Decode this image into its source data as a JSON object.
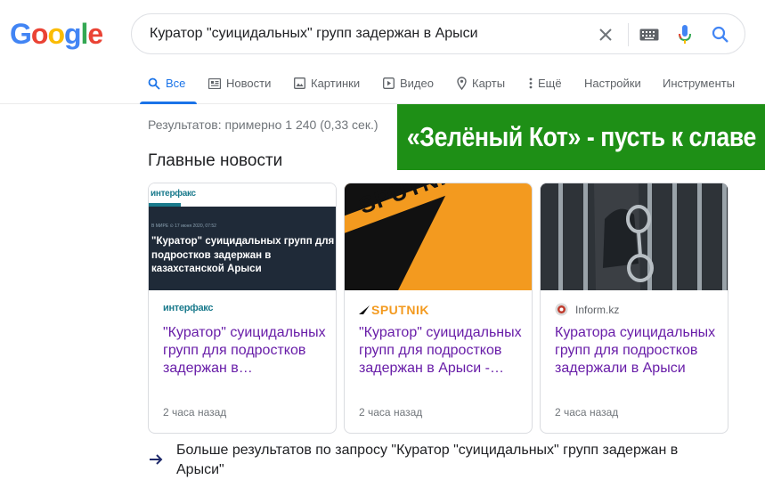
{
  "logo": {
    "letters": [
      "G",
      "o",
      "o",
      "g",
      "l",
      "e"
    ],
    "colors": [
      "#4285f4",
      "#ea4335",
      "#fbbc05",
      "#4285f4",
      "#34a853",
      "#ea4335"
    ]
  },
  "search": {
    "query": "Куратор \"суицидальных\" групп задержан в Арыси",
    "icons": [
      "clear-icon",
      "keyboard-icon",
      "mic-icon",
      "search-icon"
    ]
  },
  "tabs": [
    {
      "label": "Все",
      "icon": "search-icon"
    },
    {
      "label": "Новости",
      "icon": "news-icon"
    },
    {
      "label": "Картинки",
      "icon": "image-icon"
    },
    {
      "label": "Видео",
      "icon": "video-icon"
    },
    {
      "label": "Карты",
      "icon": "map-pin-icon"
    },
    {
      "label": "Ещё",
      "icon": "more-vert-icon"
    },
    {
      "label": "Настройки"
    },
    {
      "label": "Инструменты"
    }
  ],
  "stats": "Результатов: примерно 1 240 (0,33 сек.)",
  "banner": {
    "text": "«Зелёный Кот» - пусть к славе",
    "bg": "#1e8f16"
  },
  "top_stories": {
    "title": "Главные новости",
    "cards": [
      {
        "source": "ИНТЕРФАКС",
        "thumb_logo": "ИНТЕРФАКС",
        "thumb_meta": "В МИРЕ  ⊙ 17 июня 2020, 07:52",
        "thumb_text": "\"Куратор\" суицидальных групп для подростков задержан в казахстанской Арыси",
        "headline": "\"Куратор\" суицидальных групп для подростков задержан в…",
        "time": "2 часа назад"
      },
      {
        "source": "SPUTNIK",
        "thumb_logo": "SPUTNIK",
        "headline": "\"Куратор\" суицидальных групп для подростков задержан в Арыси -…",
        "time": "2 часа назад"
      },
      {
        "source": "Inform.kz",
        "headline": "Куратора суицидальных групп для подростков задержали в Арыси",
        "time": "2 часа назад"
      }
    ]
  },
  "more_results": "Больше результатов по запросу \"Куратор \"суицидальных\" групп задержан в Арыси\""
}
